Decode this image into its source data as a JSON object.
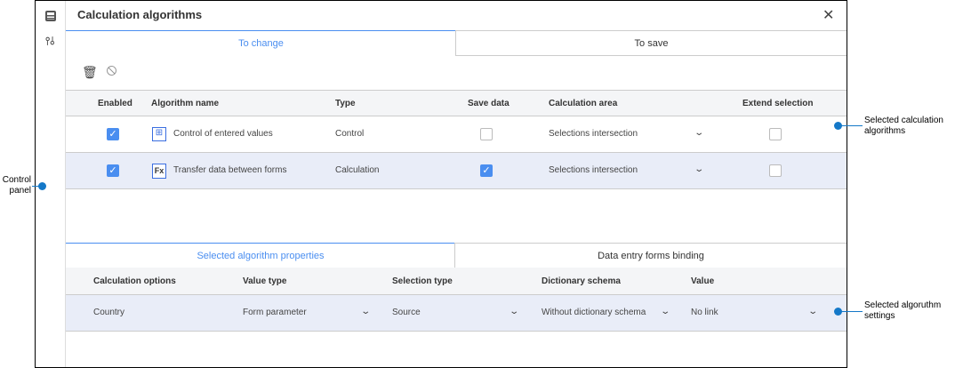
{
  "title": "Calculation algorithms",
  "tabs_top": [
    {
      "label": "To change",
      "active": true
    },
    {
      "label": "To save",
      "active": false
    }
  ],
  "grid_headers": [
    "Enabled",
    "Algorithm name",
    "Type",
    "Save data",
    "Calculation area",
    "Extend selection"
  ],
  "rows": [
    {
      "enabled": true,
      "name": "Control of entered values",
      "type": "Control",
      "save_data": false,
      "area": "Selections intersection",
      "extend": false,
      "icon": "grid-icon"
    },
    {
      "enabled": true,
      "name": "Transfer data between forms",
      "type": "Calculation",
      "save_data": true,
      "area": "Selections intersection",
      "extend": false,
      "icon": "fx-icon"
    }
  ],
  "tabs_bottom": [
    {
      "label": "Selected algorithm properties",
      "active": true
    },
    {
      "label": "Data entry forms binding",
      "active": false
    }
  ],
  "prop_headers": [
    "Calculation options",
    "Value type",
    "Selection type",
    "Dictionary schema",
    "Value"
  ],
  "prop_row": {
    "option": "Country",
    "value_type": "Form parameter",
    "selection_type": "Source",
    "dictionary_schema": "Without dictionary schema",
    "value": "No link"
  },
  "callouts": {
    "control_panel": "Control\npanel",
    "selected_algorithms": "Selected calculation\nalgorithms",
    "selected_settings": "Selected algoruthm\nsettings"
  },
  "accent": "#4a8ef0"
}
